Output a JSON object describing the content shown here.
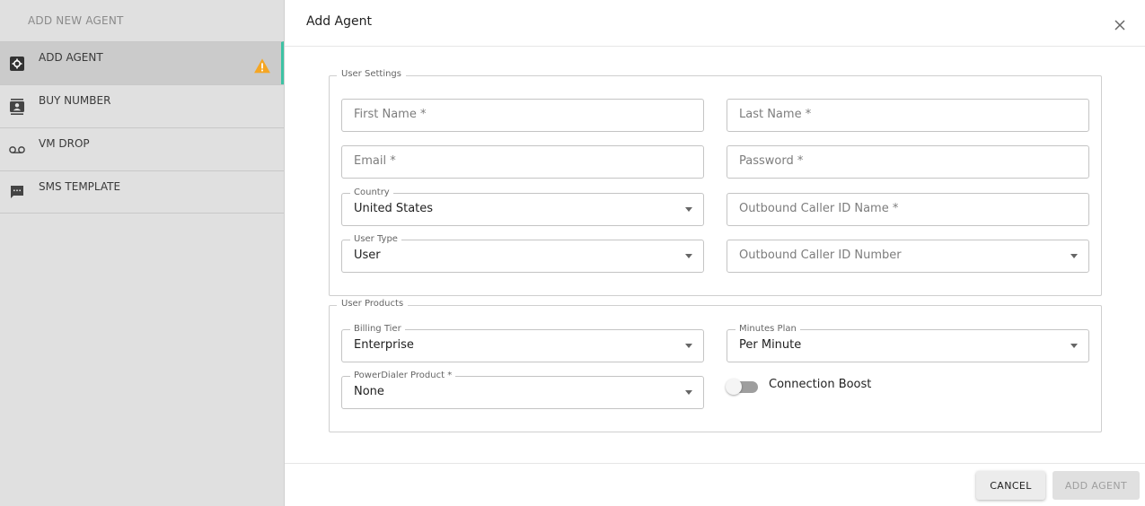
{
  "sidebar": {
    "header": "ADD NEW AGENT",
    "items": [
      {
        "label": "ADD AGENT",
        "icon": "gear-box-icon",
        "active": true
      },
      {
        "label": "BUY NUMBER",
        "icon": "contact-card-icon"
      },
      {
        "label": "VM DROP",
        "icon": "voicemail-icon"
      },
      {
        "label": "SMS TEMPLATE",
        "icon": "message-icon"
      }
    ],
    "accent_color": "#3ec2a4",
    "warning_color": "#f5a623"
  },
  "dialog": {
    "title": "Add Agent",
    "user_settings": {
      "legend": "User Settings",
      "first_name": {
        "placeholder": "First Name *"
      },
      "last_name": {
        "placeholder": "Last Name *"
      },
      "email": {
        "placeholder": "Email *"
      },
      "password": {
        "placeholder": "Password *"
      },
      "country": {
        "label": "Country",
        "value": "United States"
      },
      "caller_id_name": {
        "placeholder": "Outbound Caller ID Name *"
      },
      "user_type": {
        "label": "User Type",
        "value": "User"
      },
      "caller_id_number": {
        "placeholder": "Outbound Caller ID Number"
      }
    },
    "user_products": {
      "legend": "User Products",
      "billing_tier": {
        "label": "Billing Tier",
        "value": "Enterprise"
      },
      "minutes_plan": {
        "label": "Minutes Plan",
        "value": "Per Minute"
      },
      "powerdialer": {
        "label": "PowerDialer Product *",
        "value": "None"
      },
      "connection_boost": {
        "label": "Connection Boost",
        "enabled": false
      }
    },
    "footer": {
      "cancel_label": "CANCEL",
      "add_label": "ADD AGENT"
    }
  }
}
